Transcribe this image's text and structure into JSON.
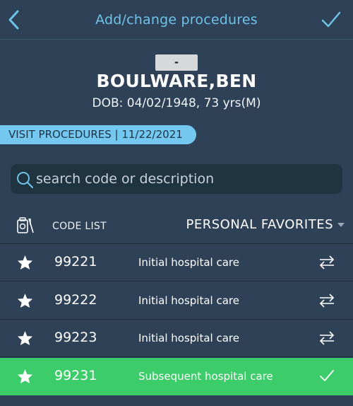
{
  "header": {
    "title": "Add/change procedures"
  },
  "patient": {
    "id_badge": "-",
    "name": "BOULWARE,BEN",
    "dob": "DOB: 04/02/1948, 73 yrs(M)"
  },
  "visit": {
    "label": "VISIT PROCEDURES | 11/22/2021"
  },
  "search": {
    "placeholder": "search code or description"
  },
  "list_header": {
    "code_list_label": "CODE LIST",
    "favorites_label": "PERSONAL FAVORITES"
  },
  "procedures": [
    {
      "code": "99221",
      "description": "Initial hospital care",
      "selected": false
    },
    {
      "code": "99222",
      "description": "Initial hospital care",
      "selected": false
    },
    {
      "code": "99223",
      "description": "Initial hospital care",
      "selected": false
    },
    {
      "code": "99231",
      "description": "Subsequent hospital care",
      "selected": true
    }
  ],
  "colors": {
    "background": "#2e4157",
    "accent": "#6fc3e8",
    "selected_row": "#3ccc6a"
  },
  "icons": [
    "back-chevron-icon",
    "checkmark-icon",
    "search-icon",
    "code-list-icon",
    "star-icon",
    "swap-arrows-icon"
  ]
}
